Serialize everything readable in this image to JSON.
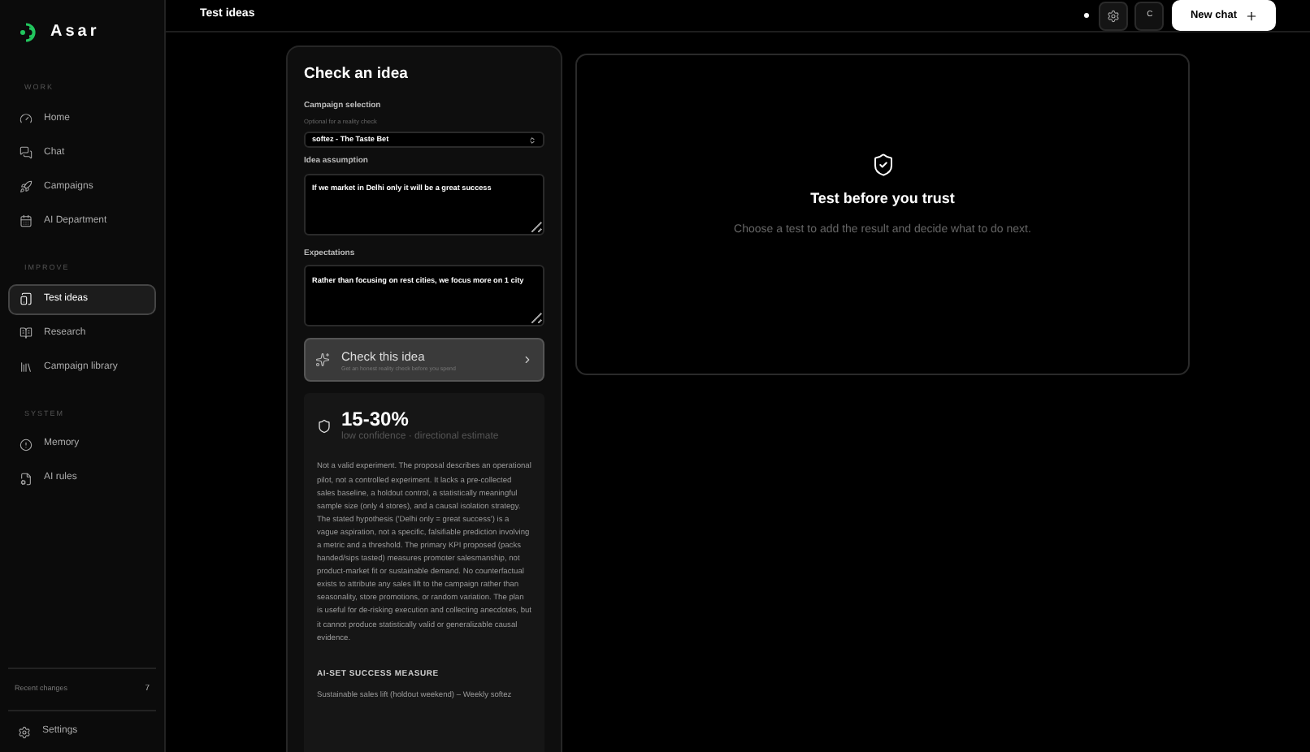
{
  "sidebar": {
    "brand": "Asar",
    "sections": [
      {
        "label": "WORK",
        "items": [
          {
            "label": "Home",
            "selected": false
          },
          {
            "label": "Chat",
            "selected": false
          },
          {
            "label": "Campaigns",
            "selected": false
          },
          {
            "label": "AI Department",
            "selected": false
          }
        ]
      },
      {
        "label": "IMPROVE",
        "items": [
          {
            "label": "Test ideas",
            "selected": true
          },
          {
            "label": "Research",
            "selected": false
          },
          {
            "label": "Campaign library",
            "selected": false
          }
        ]
      },
      {
        "label": "SYSTEM",
        "items": [
          {
            "label": "Memory",
            "selected": false
          },
          {
            "label": "AI rules",
            "selected": false
          }
        ]
      }
    ],
    "recent_changes": {
      "label": "Recent changes",
      "count": "7"
    },
    "settings": "Settings"
  },
  "header": {
    "title": "Test ideas",
    "avatar": "C",
    "new_chat": "New chat"
  },
  "form": {
    "title": "Check an idea",
    "campaign": {
      "label": "Campaign selection",
      "hint": "Optional for a reality check",
      "value": "softez - The Taste Bet"
    },
    "assumption": {
      "label": "Idea assumption",
      "value": "If we market in Delhi only it will be a great success"
    },
    "expectations": {
      "label": "Expectations",
      "value": "Rather than focusing on rest cities, we focus more on 1 city"
    },
    "check_button": {
      "label": "Check this idea",
      "subtitle": "Get an honest reality check before you spend"
    },
    "result": {
      "range": "15-30%",
      "confidence": "low confidence · directional estimate",
      "summary": "Not a valid experiment. The proposal describes an operational pilot, not a controlled experiment. It lacks a pre-collected sales baseline, a holdout control, a statistically meaningful sample size (only 4 stores), and a causal isolation strategy. The stated hypothesis ('Delhi only = great success') is a vague aspiration, not a specific, falsifiable prediction involving a metric and a threshold. The primary KPI proposed (packs handed/sips tasted) measures promoter salesmanship, not product-market fit or sustainable demand. No counterfactual exists to attribute any sales lift to the campaign rather than seasonality, store promotions, or random variation. The plan is useful for de-risking execution and collecting anecdotes, but it cannot produce statistically valid or generalizable causal evidence.",
      "measure_heading": "AI-SET SUCCESS MEASURE",
      "measure_text": "Sustainable sales lift (holdout weekend) – Weekly softez"
    }
  },
  "empty_state": {
    "title": "Test before you trust",
    "text": "Choose a test to add the result and decide what to do next."
  }
}
